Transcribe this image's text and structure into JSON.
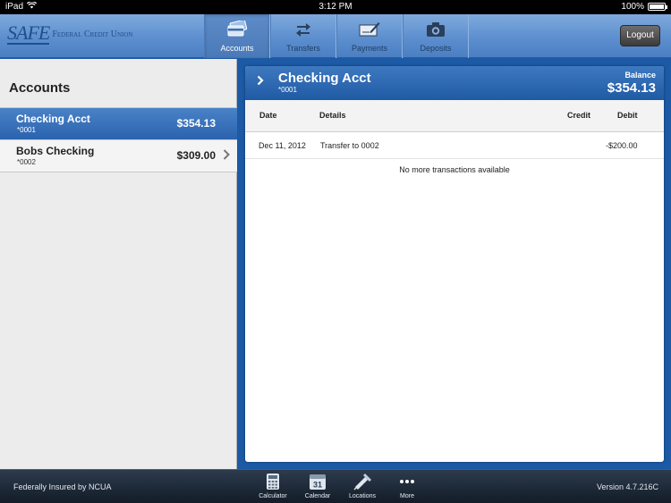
{
  "status_bar": {
    "device": "iPad",
    "time": "3:12 PM",
    "battery": "100%",
    "battery_level": 1.0
  },
  "brand": {
    "mark": "SAFE",
    "name": "Federal Credit Union"
  },
  "nav": {
    "tabs": [
      {
        "label": "Accounts",
        "icon": "card-icon",
        "active": true
      },
      {
        "label": "Transfers",
        "icon": "transfer-arrows-icon",
        "active": false
      },
      {
        "label": "Payments",
        "icon": "check-pen-icon",
        "active": false
      },
      {
        "label": "Deposits",
        "icon": "camera-icon",
        "active": false
      }
    ],
    "logout_label": "Logout"
  },
  "accounts_panel": {
    "title": "Accounts",
    "accounts": [
      {
        "name": "Checking Acct",
        "number": "*0001",
        "balance": "$354.13",
        "selected": true
      },
      {
        "name": "Bobs Checking",
        "number": "*0002",
        "balance": "$309.00",
        "selected": false
      }
    ]
  },
  "detail": {
    "account_name": "Checking Acct",
    "account_number": "*0001",
    "balance_label": "Balance",
    "balance": "$354.13",
    "columns": {
      "date": "Date",
      "details": "Details",
      "credit": "Credit",
      "debit": "Debit"
    },
    "transactions": [
      {
        "date": "Dec 11, 2012",
        "details": "Transfer to 0002",
        "credit": "",
        "debit": "-$200.00"
      }
    ],
    "empty_message": "No more transactions available"
  },
  "footer": {
    "insured": "Federally Insured by NCUA",
    "version": "Version 4.7.216C",
    "tools": [
      {
        "label": "Calculator",
        "icon": "calculator-icon"
      },
      {
        "label": "Calendar",
        "icon": "calendar-icon",
        "day": "31"
      },
      {
        "label": "Locations",
        "icon": "map-pin-icon"
      },
      {
        "label": "More",
        "icon": "more-dots-icon"
      }
    ]
  },
  "colors": {
    "accent": "#2a63ad",
    "nav_bg": "#5d8fcf",
    "footer_bg": "#1e2a38"
  }
}
